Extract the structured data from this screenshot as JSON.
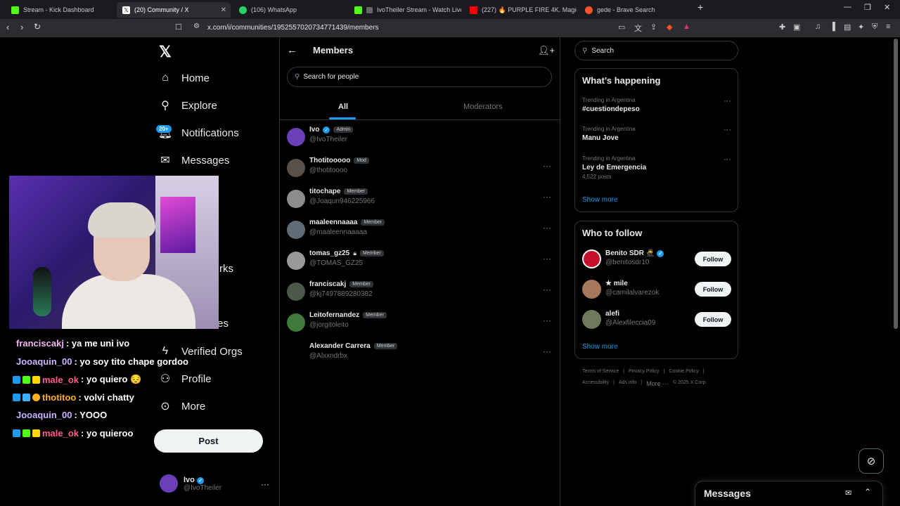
{
  "browser": {
    "tabs": [
      {
        "label": "Stream - Kick Dashboard",
        "color": "#53fc18"
      },
      {
        "label": "(20) Community / X",
        "color": "#ffffff"
      },
      {
        "label": "(106) WhatsApp",
        "color": "#25d366"
      },
      {
        "label": "IvoTheiler Stream - Watch Live on",
        "color": "#53fc18"
      },
      {
        "label": "(227) 🔥 PURPLE FIRE 4K. Magic Firep",
        "color": "#ff0000"
      },
      {
        "label": "gede - Brave Search",
        "color": "#fb542b"
      }
    ],
    "url": "x.com/i/communities/1952557020734771439/members"
  },
  "nav": {
    "items": [
      {
        "label": "Home",
        "icon": "home-icon"
      },
      {
        "label": "Explore",
        "icon": "search-icon"
      },
      {
        "label": "Notifications",
        "icon": "bell-icon"
      },
      {
        "label": "Messages",
        "icon": "mail-icon"
      },
      {
        "label": "rks",
        "icon": "bookmark-icon"
      },
      {
        "label": "nities",
        "icon": "people-icon"
      },
      {
        "label": "Verified Orgs",
        "icon": "lightning-icon"
      },
      {
        "label": "Profile",
        "icon": "person-icon"
      },
      {
        "label": "More",
        "icon": "more-circle-icon"
      }
    ],
    "notif_badge": "20+",
    "post_label": "Post",
    "me": {
      "name": "Ivo",
      "handle": "@IvoTheiler"
    }
  },
  "chat": [
    {
      "user": "franciscakj",
      "text": ": ya me uni ivo",
      "color": "#f2b6f0"
    },
    {
      "user": "Jooaquin_00",
      "text": ": yo soy tito chape gordoo",
      "color": "#c9b2ff"
    },
    {
      "user": "male_ok",
      "text": ": yo quiero 😔",
      "color": "#ff5c8a"
    },
    {
      "user": "thotitoo",
      "text": ": volvi chatty",
      "color": "#ffb020"
    },
    {
      "user": "Jooaquin_00",
      "text": ": YOOO",
      "color": "#c9b2ff"
    },
    {
      "user": "male_ok",
      "text": ": yo quieroo",
      "color": "#ff5c8a"
    }
  ],
  "members_page": {
    "title": "Members",
    "search_placeholder": "Search for people",
    "tabs": [
      "All",
      "Moderators"
    ],
    "members": [
      {
        "name": "Ivo",
        "handle": "@IvoTheiler",
        "role": "Admin",
        "verified": true,
        "avatar_color": "#6b3fb5"
      },
      {
        "name": "Thotitooooo",
        "handle": "@thotitoooo",
        "role": "Mod",
        "verified": false,
        "avatar_color": "#5a5048"
      },
      {
        "name": "titochape",
        "handle": "@Joaqun946225966",
        "role": "Member",
        "verified": false,
        "avatar_color": "#8c8c8c"
      },
      {
        "name": "maaleennaaaa",
        "handle": "@maaleennaaaaa",
        "role": "Member",
        "verified": false,
        "avatar_color": "#5f6b75"
      },
      {
        "name": "tomas_gz25",
        "handle": "@TOMAS_GZ25",
        "role": "Member",
        "verified": false,
        "avatar_color": "#9a9a9a",
        "locked": true
      },
      {
        "name": "franciscakj",
        "handle": "@kj7497889280382",
        "role": "Member",
        "verified": false,
        "avatar_color": "#4b5a48"
      },
      {
        "name": "Leitofernandez",
        "handle": "@jorgitoleito",
        "role": "Member",
        "verified": false,
        "avatar_color": "#3f7a3a"
      },
      {
        "name": "Alexander Carrera",
        "handle": "@Alxxndrbx",
        "role": "Member",
        "verified": false,
        "avatar_color": "#000000"
      }
    ]
  },
  "right": {
    "search_placeholder": "Search",
    "happening_title": "What’s happening",
    "trends": [
      {
        "context": "Trending in Argentina",
        "topic": "#cuestiondepeso",
        "posts": ""
      },
      {
        "context": "Trending in Argentina",
        "topic": "Manu Jove",
        "posts": ""
      },
      {
        "context": "Trending in Argentina",
        "topic": "Ley de Emergencia",
        "posts": "4,522 posts"
      }
    ],
    "show_more": "Show more",
    "wtf_title": "Who to follow",
    "follow_label": "Follow",
    "suggestions": [
      {
        "name": "Benito SDR 🥷",
        "handle": "@benitosdr10",
        "verified": true,
        "avatar_color": "#c8102e"
      },
      {
        "name": "★ mile",
        "handle": "@camilalvarezok",
        "verified": false,
        "avatar_color": "#a5785e"
      },
      {
        "name": "alefi",
        "handle": "@Alexfileccia09",
        "verified": false,
        "avatar_color": "#6e7a5a"
      }
    ],
    "footer_row1": [
      "Terms of Service",
      "|",
      "Privacy Policy",
      "|",
      "Cookie Policy",
      "|"
    ],
    "footer_row2": [
      "Accessibility",
      "|",
      "Ads info",
      "|",
      "More ···",
      "© 2025 X Corp."
    ]
  },
  "dock": {
    "title": "Messages"
  },
  "colors": {
    "accent": "#1d9bf0",
    "background": "#000000",
    "border": "#2f3336",
    "muted": "#71767b"
  }
}
